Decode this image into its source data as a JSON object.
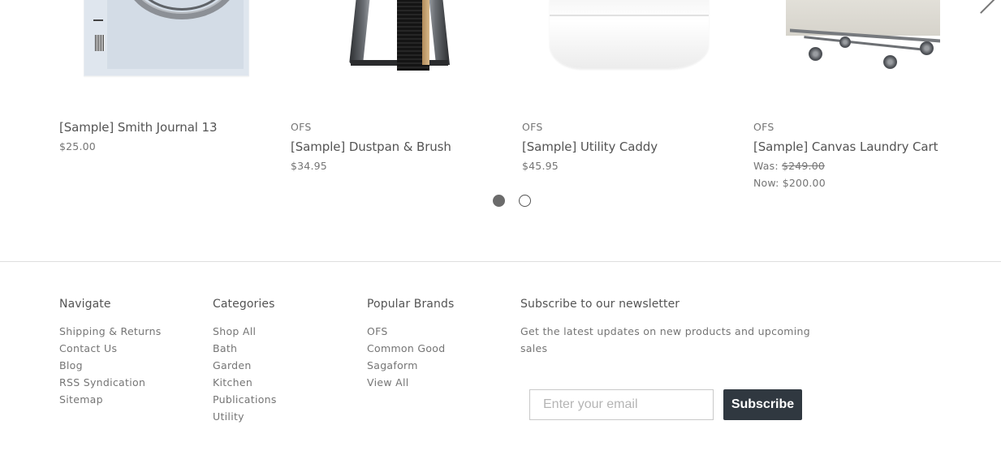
{
  "carousel": {
    "products": [
      {
        "brand": "",
        "title": "[Sample] Smith Journal 13",
        "price": "$25.00",
        "image": "smith-journal-image"
      },
      {
        "brand": "OFS",
        "title": "[Sample] Dustpan & Brush",
        "price": "$34.95",
        "image": "dustpan-brush-image"
      },
      {
        "brand": "OFS",
        "title": "[Sample] Utility Caddy",
        "price": "$45.95",
        "image": "utility-caddy-image"
      },
      {
        "brand": "OFS",
        "title": "[Sample] Canvas Laundry Cart",
        "was_label": "Was:",
        "was_price": "$249.00",
        "now_label": "Now:",
        "now_price": "$200.00",
        "image": "laundry-cart-image"
      }
    ],
    "pagination": {
      "total_pages": 2,
      "active_page": 1
    },
    "next_arrow_icon": "chevron-right-icon"
  },
  "footer": {
    "navigate": {
      "heading": "Navigate",
      "links": [
        "Shipping & Returns",
        "Contact Us",
        "Blog",
        "RSS Syndication",
        "Sitemap"
      ]
    },
    "categories": {
      "heading": "Categories",
      "links": [
        "Shop All",
        "Bath",
        "Garden",
        "Kitchen",
        "Publications",
        "Utility"
      ]
    },
    "brands": {
      "heading": "Popular Brands",
      "links": [
        "OFS",
        "Common Good",
        "Sagaform",
        "View All"
      ]
    },
    "newsletter": {
      "heading": "Subscribe to our newsletter",
      "description": "Get the latest updates on new products and upcoming sales",
      "email_placeholder": "Enter your email",
      "email_value": "",
      "subscribe_label": "Subscribe"
    }
  },
  "colors": {
    "text": "#545454",
    "muted": "#757575",
    "button_bg": "#303840",
    "divider": "#dfdfdf"
  }
}
